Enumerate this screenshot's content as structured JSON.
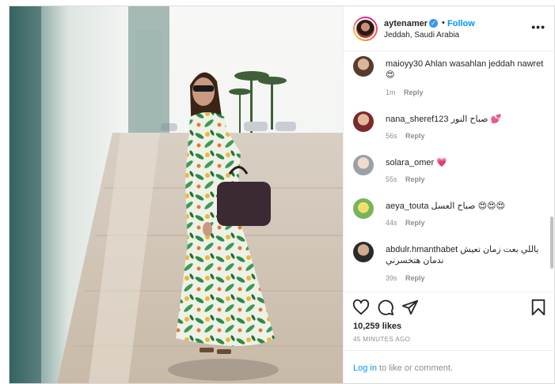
{
  "header": {
    "username": "aytenamer",
    "verified_mark": "✓",
    "separator": "•",
    "follow_label": "Follow",
    "location": "Jeddah, Saudi Arabia",
    "more_icon": "more-horizontal-icon",
    "more_label": "•••"
  },
  "comments": [
    {
      "user": "maioyy30",
      "text": "Ahlan wasahlan jeddah nawret 😍",
      "time": "1m",
      "reply": "Reply"
    },
    {
      "user": "nana_sheref123",
      "text": "صباح النور 💕",
      "time": "56s",
      "reply": "Reply"
    },
    {
      "user": "solara_omer",
      "text": "💗",
      "time": "55s",
      "reply": "Reply"
    },
    {
      "user": "aeya_touta",
      "text": "صباح العسل 😍😍😍",
      "time": "44s",
      "reply": "Reply"
    },
    {
      "user": "abdulr.hmanthabet",
      "text": "ياللي بعت زمان تعيش ندمان هتخسرني",
      "time": "39s",
      "reply": "Reply"
    }
  ],
  "actions": {
    "like_icon": "heart-icon",
    "comment_icon": "comment-icon",
    "share_icon": "share-icon",
    "save_icon": "bookmark-icon"
  },
  "likes": "10,259 likes",
  "timestamp": "45 MINUTES AGO",
  "login": {
    "link": "Log in",
    "rest": " to like or comment."
  },
  "colors": {
    "accent": "#0095f6",
    "verified": "#3897f0",
    "muted": "#8e8e8e",
    "border": "#dbdbdb"
  }
}
